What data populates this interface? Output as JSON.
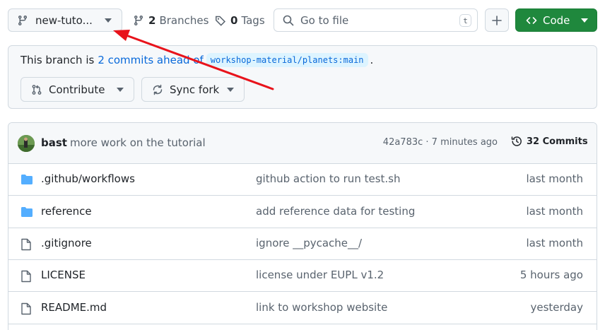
{
  "toolbar": {
    "branch_label": "new-tuto...",
    "branches_count": "2",
    "branches_label": "Branches",
    "tags_count": "0",
    "tags_label": "Tags",
    "search_placeholder": "Go to file",
    "search_shortcut": "t",
    "code_label": "Code",
    "code_color": "#1f883d"
  },
  "branch_status": {
    "prefix": "This branch is",
    "ahead_link": "2 commits ahead of",
    "base_ref": "workshop-material/planets:main",
    "suffix": ".",
    "contribute_label": "Contribute",
    "sync_label": "Sync fork"
  },
  "latest_commit": {
    "author": "bast",
    "message": "more work on the tutorial",
    "meta": "42a783c · 7 minutes ago",
    "commits_label": "32 Commits"
  },
  "files": [
    {
      "name": ".github/workflows",
      "type": "folder-icon",
      "message": "github action to run test.sh",
      "date": "last month"
    },
    {
      "name": "reference",
      "type": "folder-icon",
      "message": "add reference data for testing",
      "date": "last month"
    },
    {
      "name": ".gitignore",
      "type": "file-icon",
      "message": "ignore __pycache__/",
      "date": "last month"
    },
    {
      "name": "LICENSE",
      "type": "file-icon",
      "message": "license under EUPL v1.2",
      "date": "5 hours ago"
    },
    {
      "name": "README.md",
      "type": "file-icon",
      "message": "link to workshop website",
      "date": "yesterday"
    }
  ],
  "colors": {
    "accent_link": "#0969da",
    "folder": "#54aeff",
    "annotation_arrow": "#e8131b"
  }
}
